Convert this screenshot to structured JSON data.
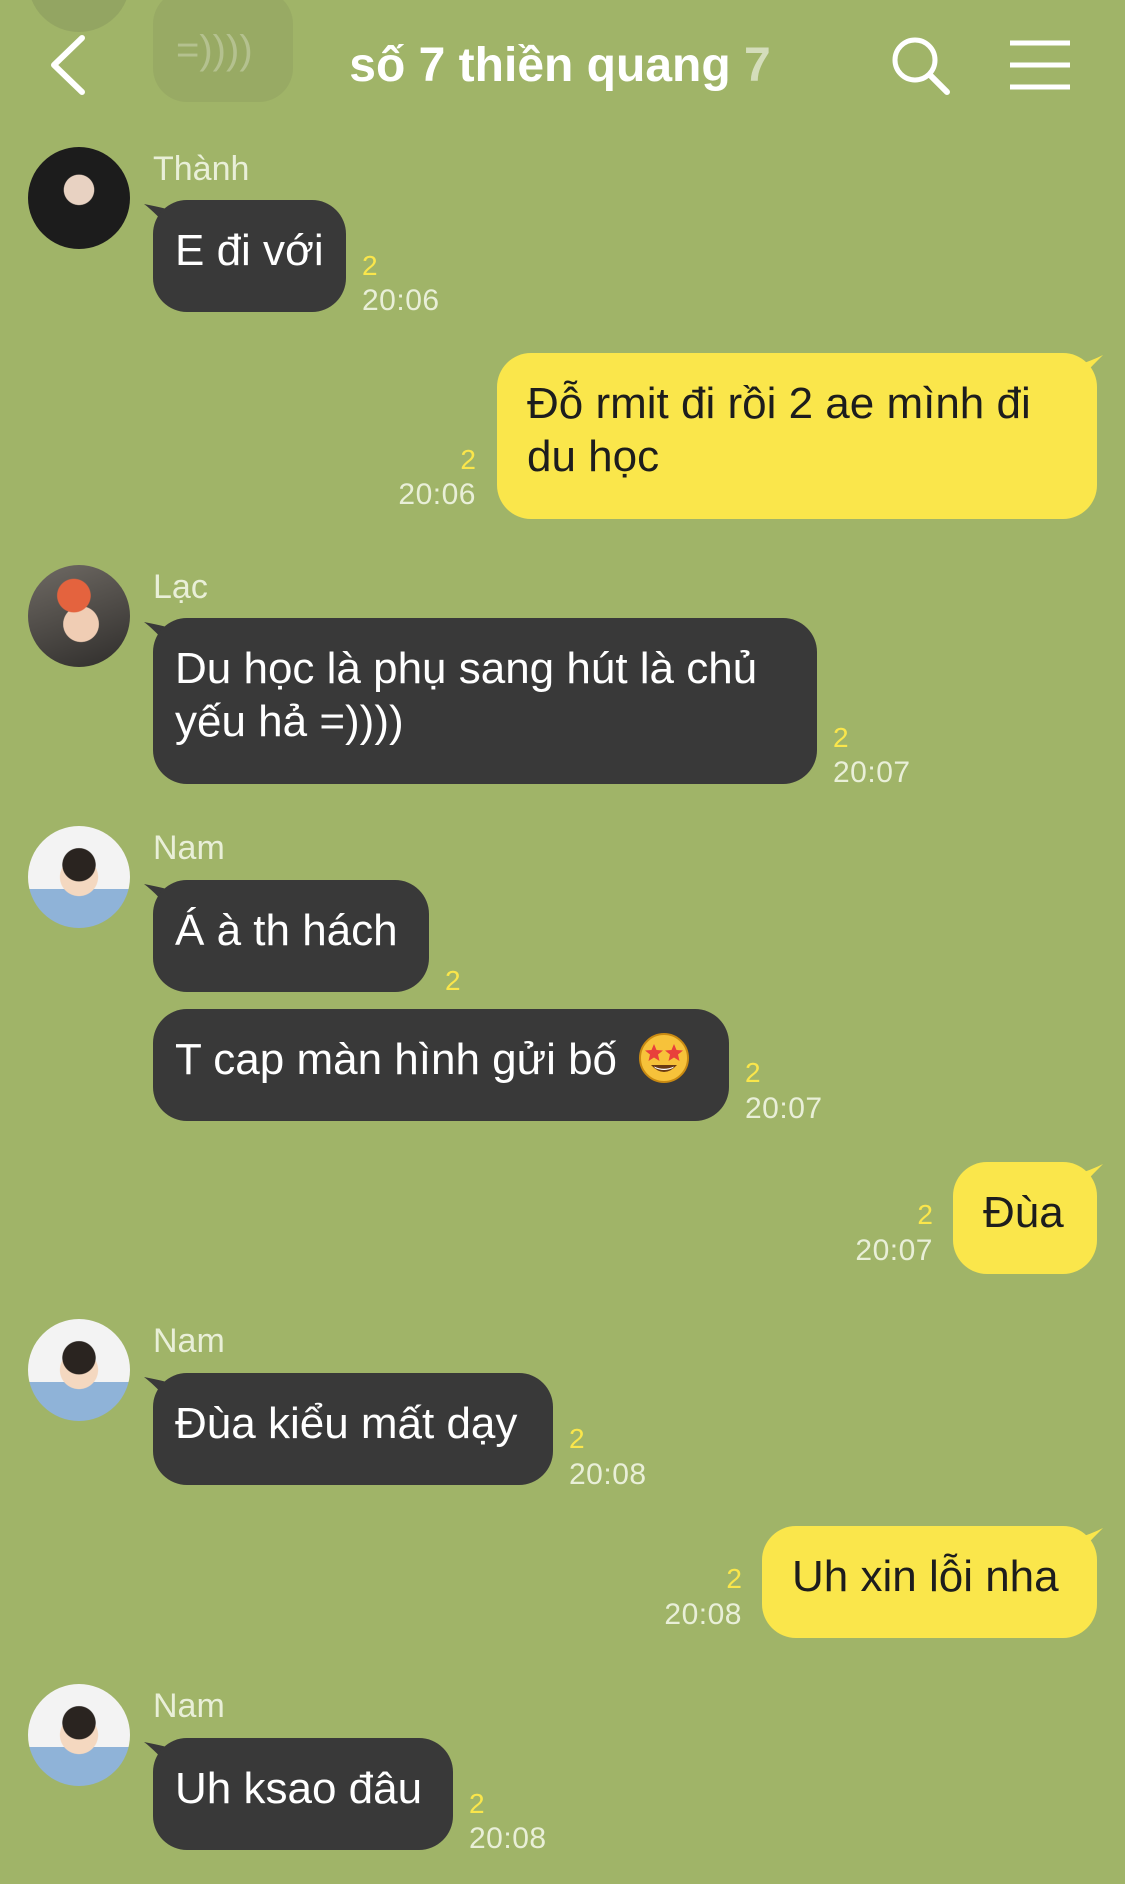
{
  "header": {
    "title": "số 7 thiền quang",
    "member_count": "7"
  },
  "previous_message": {
    "text": "=))))"
  },
  "messages": [
    {
      "sender": "Thành",
      "text": "E đi với",
      "unread": "2",
      "time": "20:06"
    },
    {
      "text": "Đỗ rmit đi rồi 2 ae mình đi",
      "text2": "du học",
      "unread": "2",
      "time": "20:06"
    },
    {
      "sender": "Lạc",
      "text": "Du học là phụ sang hút là chủ",
      "text2": "yếu hả =))))",
      "unread": "2",
      "time": "20:07"
    },
    {
      "sender": "Nam",
      "text": "Á à th hách",
      "unread": "2"
    },
    {
      "text": "T cap màn hình gửi bố",
      "unread": "2",
      "time": "20:07"
    },
    {
      "text": "Đùa",
      "unread": "2",
      "time": "20:07"
    },
    {
      "sender": "Nam",
      "text": "Đùa kiểu mất dạy",
      "unread": "2",
      "time": "20:08"
    },
    {
      "text": "Uh xin lỗi nha",
      "unread": "2",
      "time": "20:08"
    },
    {
      "sender": "Nam",
      "text": "Uh ksao đâu",
      "unread": "2",
      "time": "20:08"
    }
  ],
  "colors": {
    "background": "#a0b468",
    "incoming_bubble": "#393939",
    "outgoing_bubble": "#fae64b",
    "unread_count": "#fae64b"
  },
  "icons": [
    "chevron-left-icon",
    "search-icon",
    "hamburger-menu-icon",
    "star-struck-emoji-icon"
  ]
}
